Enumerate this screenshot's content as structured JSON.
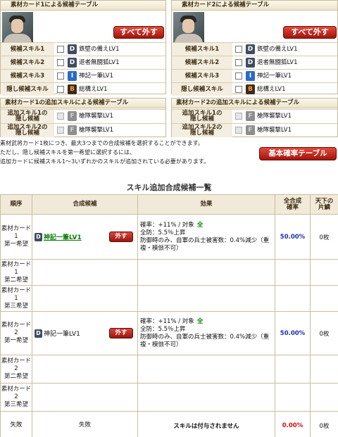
{
  "card1": {
    "title": "素材カード1による候補テーブル",
    "remove_all": "すべて外す",
    "rows": [
      {
        "label": "候補スキル1",
        "icon": "D",
        "skill": "鉄壁の備えLV1"
      },
      {
        "label": "候補スキル2",
        "icon": "D",
        "skill": "退者無闘狐LV1"
      },
      {
        "label": "候補スキル3",
        "icon": "I",
        "skill": "神記一筆LV1"
      },
      {
        "label": "隠し候補スキル",
        "icon": "B",
        "skill": "総構えLV1"
      }
    ]
  },
  "card2": {
    "title": "素材カード2による候補テーブル",
    "remove_all": "すべて外す",
    "rows": [
      {
        "label": "候補スキル1",
        "icon": "D",
        "skill": "鉄壁の備えLV1"
      },
      {
        "label": "候補スキル2",
        "icon": "D",
        "skill": "退者無闘狐LV1"
      },
      {
        "label": "候補スキル3",
        "icon": "I",
        "skill": "神記一筆LV1"
      },
      {
        "label": "隠し候補スキル",
        "icon": "B",
        "skill": "総構えLV1"
      }
    ]
  },
  "add1": {
    "title": "素材カード1の追加スキルによる候補テーブル",
    "rows": [
      {
        "label_a": "追加スキル1の",
        "label_b": "隠し候補",
        "icon": "F",
        "skill": "槍隊襲撃LV1"
      },
      {
        "label_a": "追加スキル2の",
        "label_b": "隠し候補",
        "icon": "F",
        "skill": "槍隊襲撃LV1"
      }
    ]
  },
  "add2": {
    "title": "素材カード2の追加スキルによる候補テーブル",
    "rows": [
      {
        "label_a": "追加スキル1の",
        "label_b": "隠し候補",
        "icon": "F",
        "skill": "槍隊襲撃LV1"
      },
      {
        "label_a": "追加スキル2の",
        "label_b": "隠し候補",
        "icon": "F",
        "skill": "槍隊襲撃LV1"
      }
    ]
  },
  "notes": {
    "line1": "素材武将カード1枚につき、最大3つまでの合成候補を選択することができます。",
    "line2": "ただし、隠し候補スキルを第一希望に選択するには、",
    "line3": "追加カードに候補スキル1～3いずれかのスキルが追加されている必要があります。"
  },
  "base_rate_button": "基本確率テーブル",
  "list": {
    "title": "スキル追加合成候補一覧",
    "headers": {
      "order": "順序",
      "candidate": "合成候補",
      "effect": "効果",
      "rate_a": "全合成",
      "rate_b": "確率",
      "stock_a": "天下の",
      "stock_b": "片鱗"
    },
    "remove_label": "外す",
    "rows": [
      {
        "order_a": "素材カード1",
        "order_b": "第一希望",
        "skill": "神記一筆LV1",
        "linked": true,
        "eff_rate": "確率：+11%",
        "eff_sep": " / ",
        "eff_target": "対象",
        "eff_all": "全",
        "eff_line2": "全防：5.5％上昇",
        "eff_line3": "防御時のみ、自軍の兵士被害数：0.4%減少（重複・模倣不可）",
        "rate": "50.00%",
        "stock": "0枚"
      },
      {
        "order_a": "素材カード1",
        "order_b": "第二希望"
      },
      {
        "order_a": "素材カード1",
        "order_b": "第三希望"
      },
      {
        "order_a": "素材カード2",
        "order_b": "第一希望",
        "skill": "神記一筆LV1",
        "linked": false,
        "eff_rate": "確率：+11%",
        "eff_sep": " / ",
        "eff_target": "対象",
        "eff_all": "全",
        "eff_line2": "全防：5.5％上昇",
        "eff_line3": "防御時のみ、自軍の兵士被害数：0.4%減少（重複・模倣不可）",
        "rate": "50.00%",
        "stock": "0枚"
      },
      {
        "order_a": "素材カード2",
        "order_b": "第二希望"
      },
      {
        "order_a": "素材カード2",
        "order_b": "第三希望"
      }
    ],
    "fail": {
      "order": "失敗",
      "candidate": "失敗",
      "effect": "スキルは付与されません",
      "rate": "0.00%",
      "stock": "0枚"
    }
  }
}
